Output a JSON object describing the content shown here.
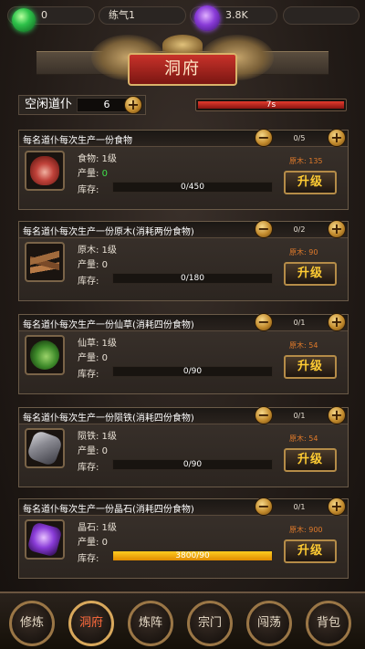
{
  "topbar": {
    "gem_value": "0",
    "realm": "练气1",
    "crystal_value": "3.8K"
  },
  "title": "洞府",
  "idle": {
    "label": "空闲道仆",
    "value": "6"
  },
  "timer": {
    "text": "7s",
    "progress": 1.0
  },
  "cards": [
    {
      "title": "每名道仆每次生产一份食物",
      "count": "0/5",
      "icon": "meat-icon",
      "level": "食物: 1级",
      "yield_label": "产量:",
      "yield_value": "0",
      "store_label": "库存:",
      "store_text": "0/450",
      "store_progress": 0,
      "cost": "原木: 135",
      "upgrade": "升级"
    },
    {
      "title": "每名道仆每次生产一份原木(消耗两份食物)",
      "count": "0/2",
      "icon": "wood-icon",
      "level": "原木: 1级",
      "yield_label": "产量:",
      "yield_value": "0",
      "store_label": "库存:",
      "store_text": "0/180",
      "store_progress": 0,
      "cost": "原木: 90",
      "upgrade": "升级"
    },
    {
      "title": "每名道仆每次生产一份仙草(消耗四份食物)",
      "count": "0/1",
      "icon": "herb-icon",
      "level": "仙草: 1级",
      "yield_label": "产量:",
      "yield_value": "0",
      "store_label": "库存:",
      "store_text": "0/90",
      "store_progress": 0,
      "cost": "原木: 54",
      "upgrade": "升级"
    },
    {
      "title": "每名道仆每次生产一份陨铁(消耗四份食物)",
      "count": "0/1",
      "icon": "iron-icon",
      "level": "陨铁: 1级",
      "yield_label": "产量:",
      "yield_value": "0",
      "store_label": "库存:",
      "store_text": "0/90",
      "store_progress": 0,
      "cost": "原木: 54",
      "upgrade": "升级"
    },
    {
      "title": "每名道仆每次生产一份晶石(消耗四份食物)",
      "count": "0/1",
      "icon": "crystal-icon",
      "level": "晶石: 1级",
      "yield_label": "产量:",
      "yield_value": "0",
      "store_label": "库存:",
      "store_text": "3800/90",
      "store_progress": 1.0,
      "cost": "原木: 900",
      "upgrade": "升级"
    }
  ],
  "nav": [
    {
      "label": "修炼",
      "active": false
    },
    {
      "label": "洞府",
      "active": true
    },
    {
      "label": "炼阵",
      "active": false
    },
    {
      "label": "宗门",
      "active": false
    },
    {
      "label": "闯荡",
      "active": false
    },
    {
      "label": "背包",
      "active": false
    }
  ],
  "colors": {
    "accent_gold": "#ffcc33",
    "cost_orange": "#e07a2a",
    "yield_green": "#3fe04a",
    "timer_red": "#e23b2e",
    "nav_active": "#ff6a3c"
  }
}
